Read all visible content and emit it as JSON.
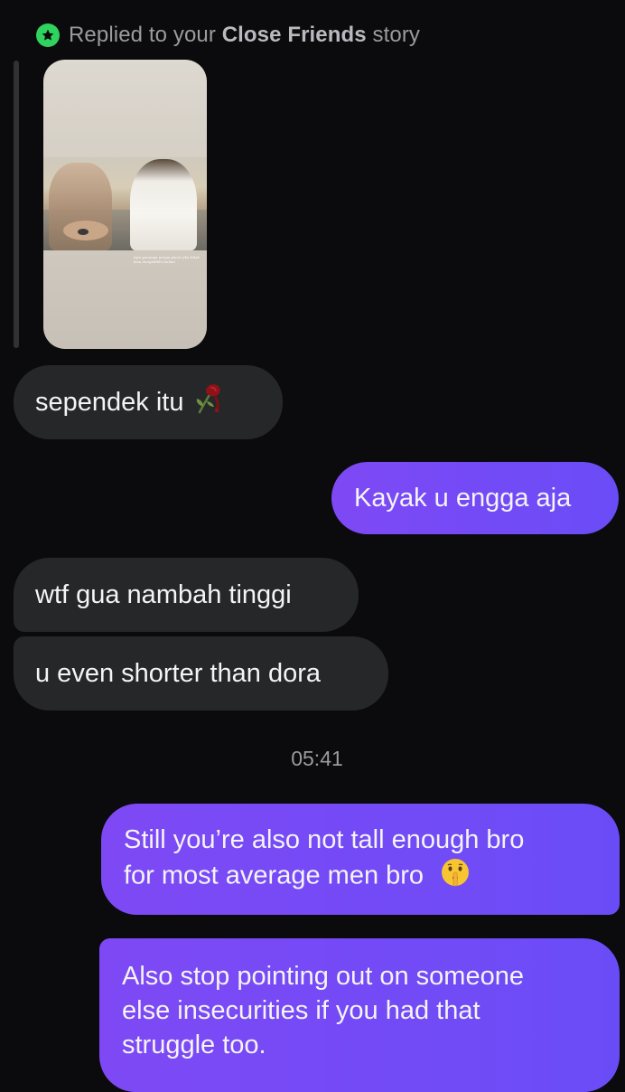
{
  "reply_header": {
    "prefix": "Replied to your",
    "bold": "Close Friends",
    "suffix": "story"
  },
  "story": {
    "caption": "Apa gunanya punya pacar jika tidak bisa menjadikhi bulian"
  },
  "messages": [
    {
      "sender": "other",
      "text": "sependek itu",
      "emoji": "wilted-rose"
    },
    {
      "sender": "me",
      "text": "Kayak u engga aja"
    },
    {
      "sender": "other",
      "text": "wtf gua nambah tinggi"
    },
    {
      "sender": "other",
      "text": "u even shorter than dora"
    },
    {
      "sender": "me",
      "lines": [
        "Still you’re also not tall enough bro",
        "for most average men bro"
      ],
      "emoji": "shushing-face"
    },
    {
      "sender": "me",
      "lines": [
        "Also stop pointing out on someone",
        "else insecurities if you had that",
        "struggle too."
      ]
    }
  ],
  "timestamp": "05:41",
  "colors": {
    "background": "#0b0b0d",
    "incoming_bubble": "#262729",
    "outgoing_bubble_start": "#7e49f5",
    "outgoing_bubble_end": "#6a4cf7",
    "close_friends_badge": "#2fd35e"
  }
}
